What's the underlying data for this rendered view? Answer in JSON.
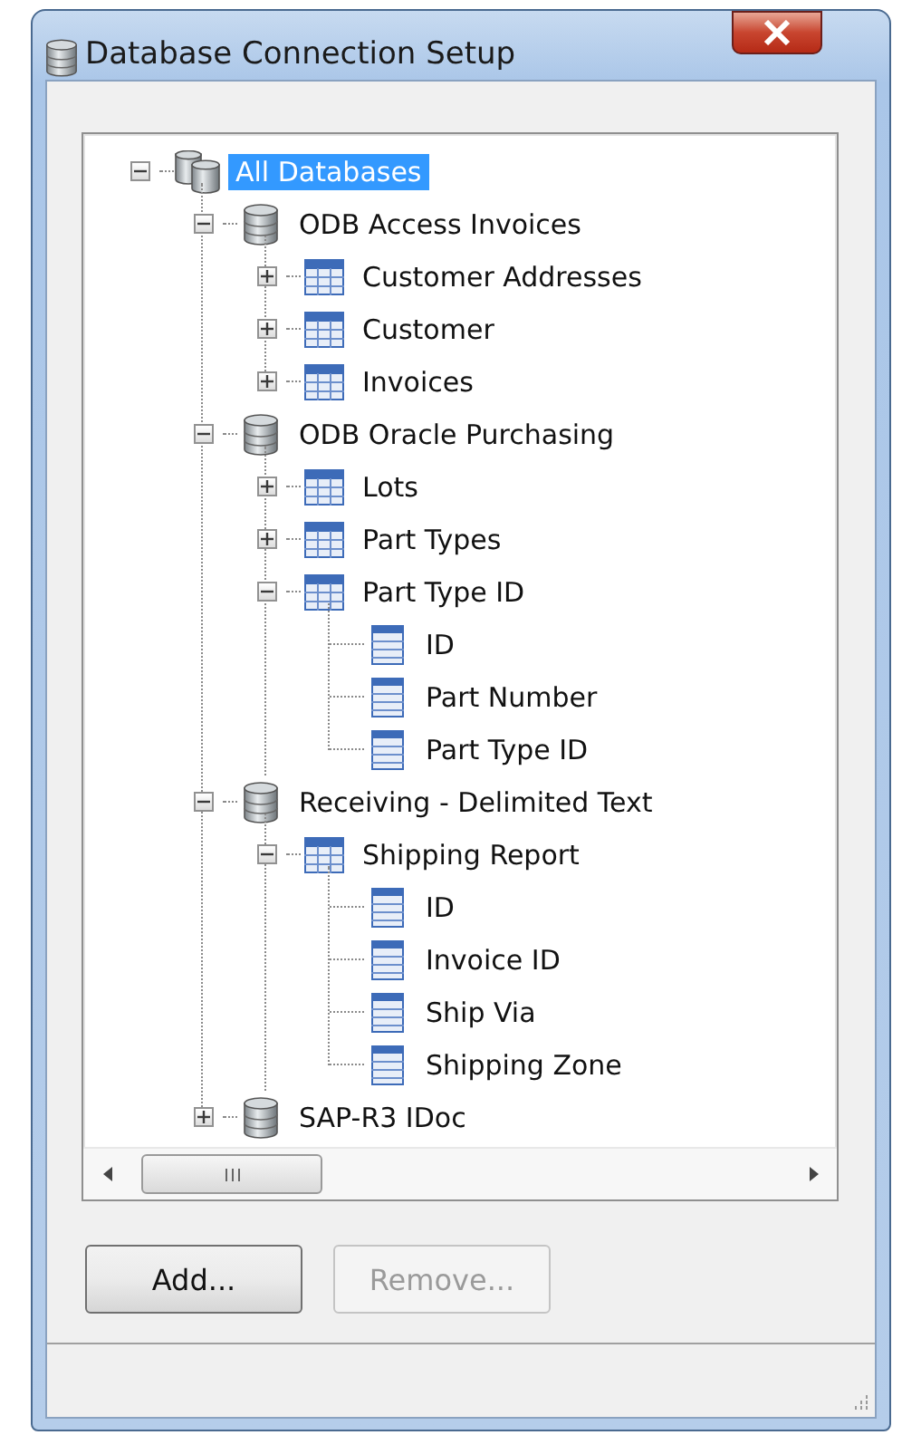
{
  "window": {
    "title": "Database Connection Setup"
  },
  "tree": [
    {
      "kind": "root",
      "label": "All Databases",
      "selected": true,
      "expanded": true,
      "children": [
        {
          "kind": "database",
          "label": "ODB Access Invoices",
          "selected": false,
          "expanded": true,
          "children": [
            {
              "kind": "table",
              "label": "Customer Addresses",
              "selected": false,
              "expanded": false
            },
            {
              "kind": "table",
              "label": "Customer",
              "selected": false,
              "expanded": false
            },
            {
              "kind": "table",
              "label": "Invoices",
              "selected": false,
              "expanded": false
            }
          ]
        },
        {
          "kind": "database",
          "label": "ODB Oracle Purchasing",
          "selected": false,
          "expanded": true,
          "children": [
            {
              "kind": "table",
              "label": "Lots",
              "selected": false,
              "expanded": false
            },
            {
              "kind": "table",
              "label": "Part Types",
              "selected": false,
              "expanded": false
            },
            {
              "kind": "table",
              "label": "Part Type ID",
              "selected": false,
              "expanded": true,
              "children": [
                {
                  "kind": "column",
                  "label": "ID",
                  "selected": false
                },
                {
                  "kind": "column",
                  "label": "Part Number",
                  "selected": false
                },
                {
                  "kind": "column",
                  "label": "Part Type ID",
                  "selected": false
                }
              ]
            }
          ]
        },
        {
          "kind": "database",
          "label": "Receiving - Delimited Text",
          "selected": false,
          "expanded": true,
          "children": [
            {
              "kind": "table",
              "label": "Shipping Report",
              "selected": false,
              "expanded": true,
              "children": [
                {
                  "kind": "column",
                  "label": "ID",
                  "selected": false
                },
                {
                  "kind": "column",
                  "label": "Invoice ID",
                  "selected": false
                },
                {
                  "kind": "column",
                  "label": "Ship Via",
                  "selected": false
                },
                {
                  "kind": "column",
                  "label": "Shipping Zone",
                  "selected": false
                }
              ]
            }
          ]
        },
        {
          "kind": "database",
          "label": "SAP-R3 IDoc",
          "selected": false,
          "expanded": false
        }
      ]
    }
  ],
  "buttons": [
    {
      "label": "Add...",
      "disabled": false
    },
    {
      "label": "Remove...",
      "disabled": true
    }
  ]
}
